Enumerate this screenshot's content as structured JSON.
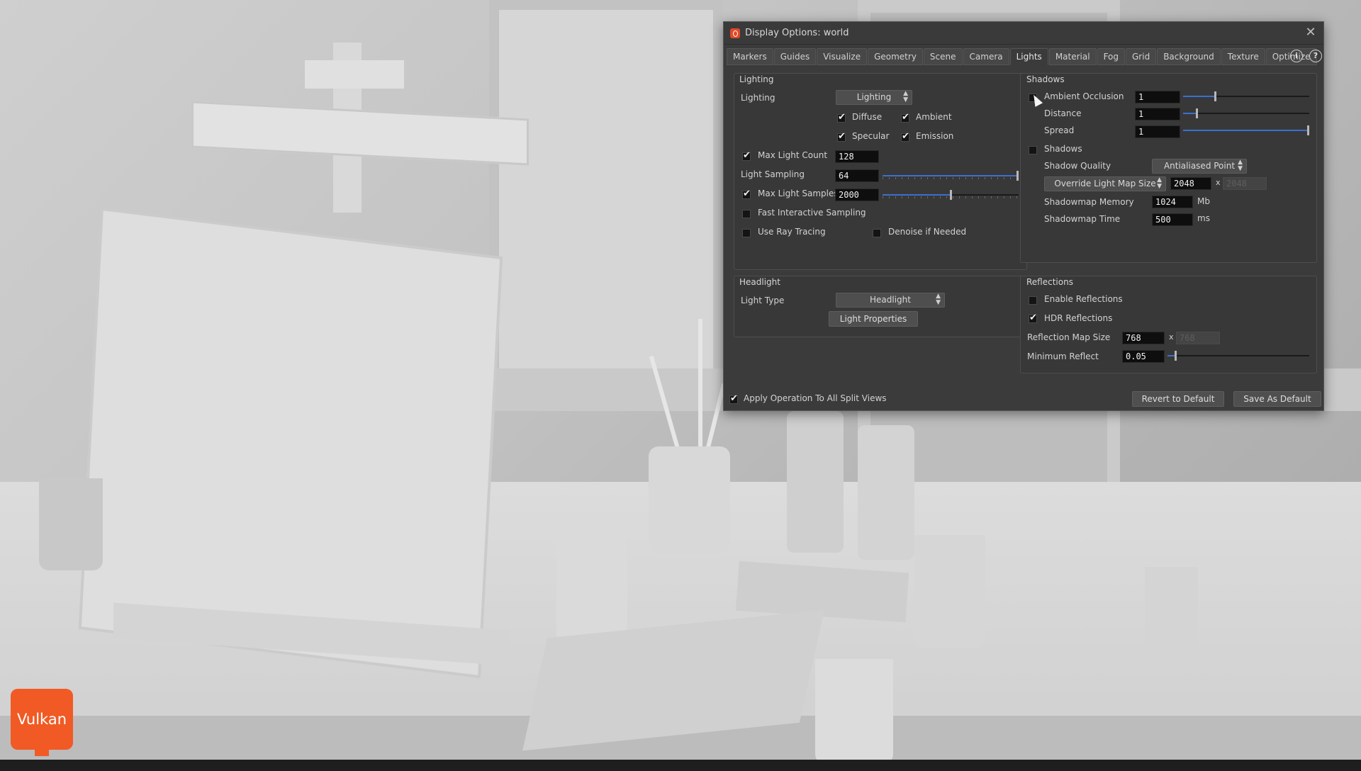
{
  "badge": {
    "label": "Vulkan"
  },
  "dialog": {
    "title": "Display Options:  world",
    "tabs": [
      "Markers",
      "Guides",
      "Visualize",
      "Geometry",
      "Scene",
      "Camera",
      "Lights",
      "Material",
      "Fog",
      "Grid",
      "Background",
      "Texture",
      "Optimize"
    ],
    "active_tab": "Lights",
    "lighting": {
      "group_title": "Lighting",
      "lighting_label": "Lighting",
      "lighting_value": "Lighting",
      "diffuse": "Diffuse",
      "ambient": "Ambient",
      "specular": "Specular",
      "emission": "Emission",
      "max_light_count_label": "Max Light Count",
      "max_light_count": "128",
      "light_sampling_label": "Light Sampling",
      "light_sampling": "64",
      "light_sampling_slider": 1.0,
      "max_light_samples_label": "Max Light Samples",
      "max_light_samples": "2000",
      "max_light_samples_slider": 0.5,
      "fast_interactive_label": "Fast Interactive Sampling",
      "use_ray_tracing_label": "Use Ray Tracing",
      "denoise_label": "Denoise if Needed"
    },
    "headlight": {
      "group_title": "Headlight",
      "light_type_label": "Light Type",
      "light_type_value": "Headlight",
      "light_properties_label": "Light Properties"
    },
    "shadows": {
      "group_title": "Shadows",
      "ambient_occlusion_label": "Ambient Occlusion",
      "ambient_occlusion": "1",
      "ambient_occlusion_slider": 0.25,
      "distance_label": "Distance",
      "distance": "1",
      "distance_slider": 0.1,
      "spread_label": "Spread",
      "spread": "1",
      "spread_slider": 1.0,
      "shadows_label": "Shadows",
      "shadow_quality_label": "Shadow Quality",
      "shadow_quality_value": "Antialiased Point",
      "override_label": "Override Light Map Size",
      "map_size_1": "2048",
      "map_size_sep": "x",
      "map_size_2": "2048",
      "memory_label": "Shadowmap Memory",
      "memory": "1024",
      "memory_unit": "Mb",
      "time_label": "Shadowmap Time",
      "time": "500",
      "time_unit": "ms"
    },
    "reflections": {
      "group_title": "Reflections",
      "enable_label": "Enable Reflections",
      "hdr_label": "HDR Reflections",
      "map_size_label": "Reflection Map Size",
      "map_size_1": "768",
      "map_size_sep": "x",
      "map_size_2": "768",
      "min_reflect_label": "Minimum Reflect",
      "min_reflect": "0.05",
      "min_reflect_slider": 0.05
    },
    "footer": {
      "apply_label": "Apply Operation To All Split Views",
      "revert_label": "Revert to Default",
      "save_label": "Save As Default"
    },
    "info_icon": "i",
    "help_icon": "?",
    "close_icon": "✕"
  }
}
